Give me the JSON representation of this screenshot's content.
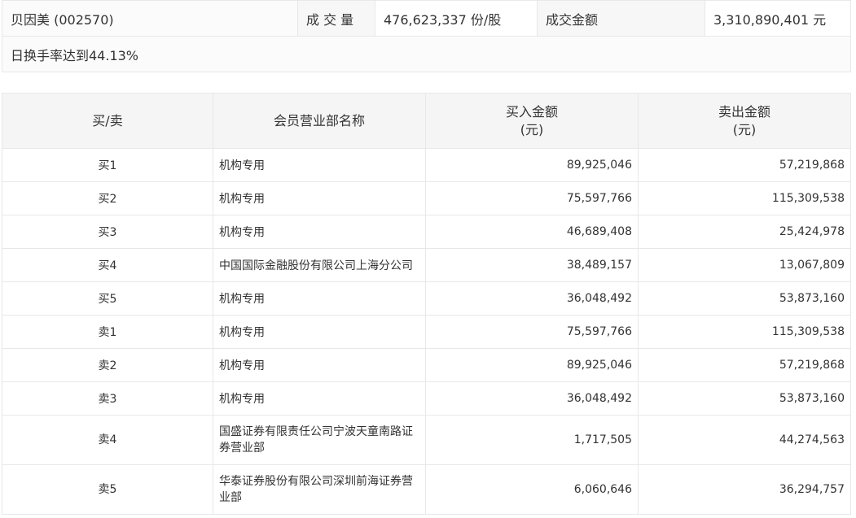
{
  "summary": {
    "stock_name": "贝因美 (002570)",
    "volume_label": "成 交 量",
    "volume_value": "476,623,337 份/股",
    "amount_label": "成交金额",
    "amount_value": "3,310,890,401 元",
    "turnover_note": "日换手率达到44.13%"
  },
  "table": {
    "headers": {
      "side": "买/卖",
      "broker": "会员营业部名称",
      "buy_line1": "买入金额",
      "buy_line2": "(元)",
      "sell_line1": "卖出金额",
      "sell_line2": "(元)"
    },
    "rows": [
      {
        "side": "买1",
        "broker": "机构专用",
        "buy": "89,925,046",
        "sell": "57,219,868"
      },
      {
        "side": "买2",
        "broker": "机构专用",
        "buy": "75,597,766",
        "sell": "115,309,538"
      },
      {
        "side": "买3",
        "broker": "机构专用",
        "buy": "46,689,408",
        "sell": "25,424,978"
      },
      {
        "side": "买4",
        "broker": "中国国际金融股份有限公司上海分公司",
        "buy": "38,489,157",
        "sell": "13,067,809"
      },
      {
        "side": "买5",
        "broker": "机构专用",
        "buy": "36,048,492",
        "sell": "53,873,160"
      },
      {
        "side": "卖1",
        "broker": "机构专用",
        "buy": "75,597,766",
        "sell": "115,309,538"
      },
      {
        "side": "卖2",
        "broker": "机构专用",
        "buy": "89,925,046",
        "sell": "57,219,868"
      },
      {
        "side": "卖3",
        "broker": "机构专用",
        "buy": "36,048,492",
        "sell": "53,873,160"
      },
      {
        "side": "卖4",
        "broker": "国盛证券有限责任公司宁波天童南路证券营业部",
        "buy": "1,717,505",
        "sell": "44,274,563"
      },
      {
        "side": "卖5",
        "broker": "华泰证券股份有限公司深圳前海证券营业部",
        "buy": "6,060,646",
        "sell": "36,294,757"
      }
    ]
  }
}
